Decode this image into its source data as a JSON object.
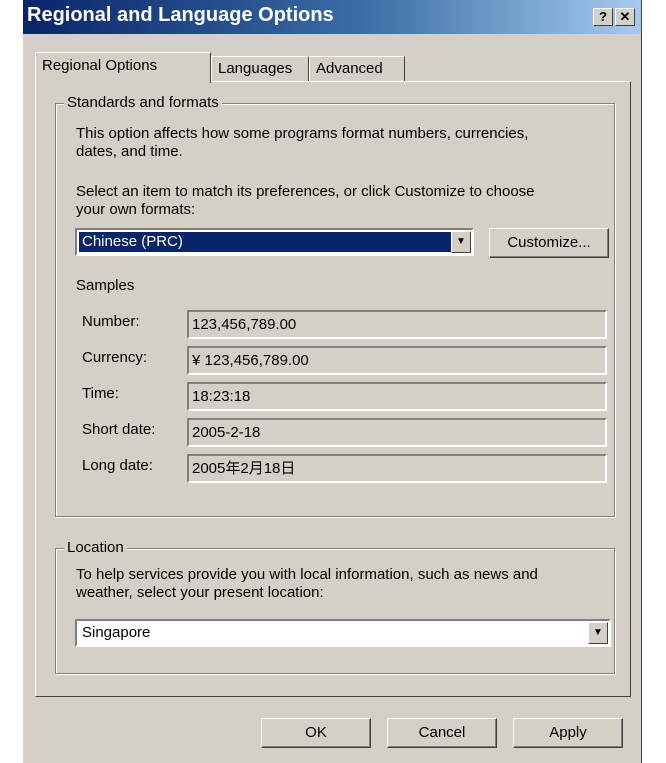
{
  "window": {
    "title": "Regional and Language Options"
  },
  "titlebar": {
    "help_label": "?",
    "close_label": "✕"
  },
  "tabs": [
    {
      "label": "Regional Options"
    },
    {
      "label": "Languages"
    },
    {
      "label": "Advanced"
    }
  ],
  "standards": {
    "group_title": "Standards and formats",
    "desc_line1": "This option affects how some programs format numbers, currencies,",
    "desc_line2": "dates, and time.",
    "select_line1": "Select an item to match its preferences, or click Customize to choose",
    "select_line2": "your own formats:",
    "format_value": "Chinese (PRC)",
    "customize_label": "Customize..."
  },
  "samples": {
    "heading": "Samples",
    "rows": [
      {
        "label": "Number:",
        "value": "123,456,789.00"
      },
      {
        "label": "Currency:",
        "value": "¥ 123,456,789.00"
      },
      {
        "label": "Time:",
        "value": "18:23:18"
      },
      {
        "label": "Short date:",
        "value": "2005-2-18"
      },
      {
        "label": "Long date:",
        "value": "2005年2月18日"
      }
    ]
  },
  "location": {
    "group_title": "Location",
    "desc_line1": "To help services provide you with local information, such as news and",
    "desc_line2": "weather, select your present location:",
    "value": "Singapore"
  },
  "buttons": {
    "ok": "OK",
    "cancel": "Cancel",
    "apply": "Apply"
  },
  "icons": {
    "dropdown": "chevron-down-icon"
  },
  "colors": {
    "title_start": "#0a246a",
    "title_end": "#a6caf0",
    "face": "#d4d0c8",
    "selection": "#0a246a"
  }
}
